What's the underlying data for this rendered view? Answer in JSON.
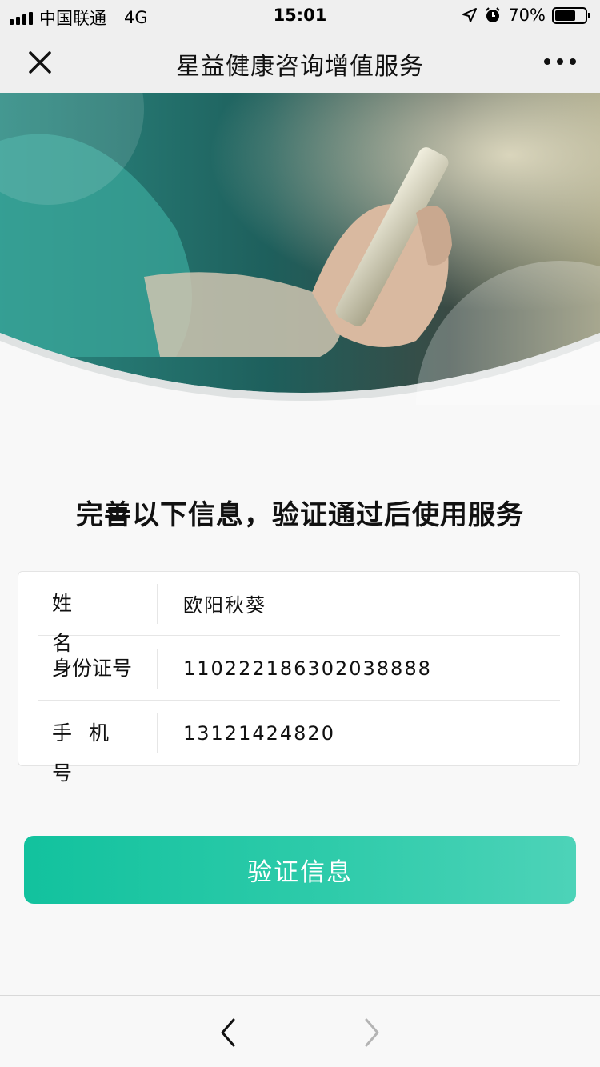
{
  "status_bar": {
    "carrier": "中国联通",
    "network": "4G",
    "time": "15:01",
    "battery_percent": "70%",
    "battery_level": 0.7
  },
  "nav": {
    "title": "星益健康咨询增值服务"
  },
  "form": {
    "heading": "完善以下信息，验证通过后使用服务",
    "fields": [
      {
        "label": "姓名",
        "value": "欧阳秋葵"
      },
      {
        "label": "身份证号",
        "value": "110222186302038888"
      },
      {
        "label": "手机号",
        "value": "13121424820"
      }
    ]
  },
  "verify_button": {
    "label": "验证信息"
  },
  "colors": {
    "accent": "#1ec6a2",
    "hero_teal": "#2f8f86"
  },
  "icons": {
    "close": "close-icon",
    "more": "more-icon",
    "back": "chevron-left-icon",
    "forward": "chevron-right-icon",
    "location": "location-arrow-icon",
    "alarm": "alarm-icon",
    "battery": "battery-icon",
    "signal": "signal-icon"
  }
}
